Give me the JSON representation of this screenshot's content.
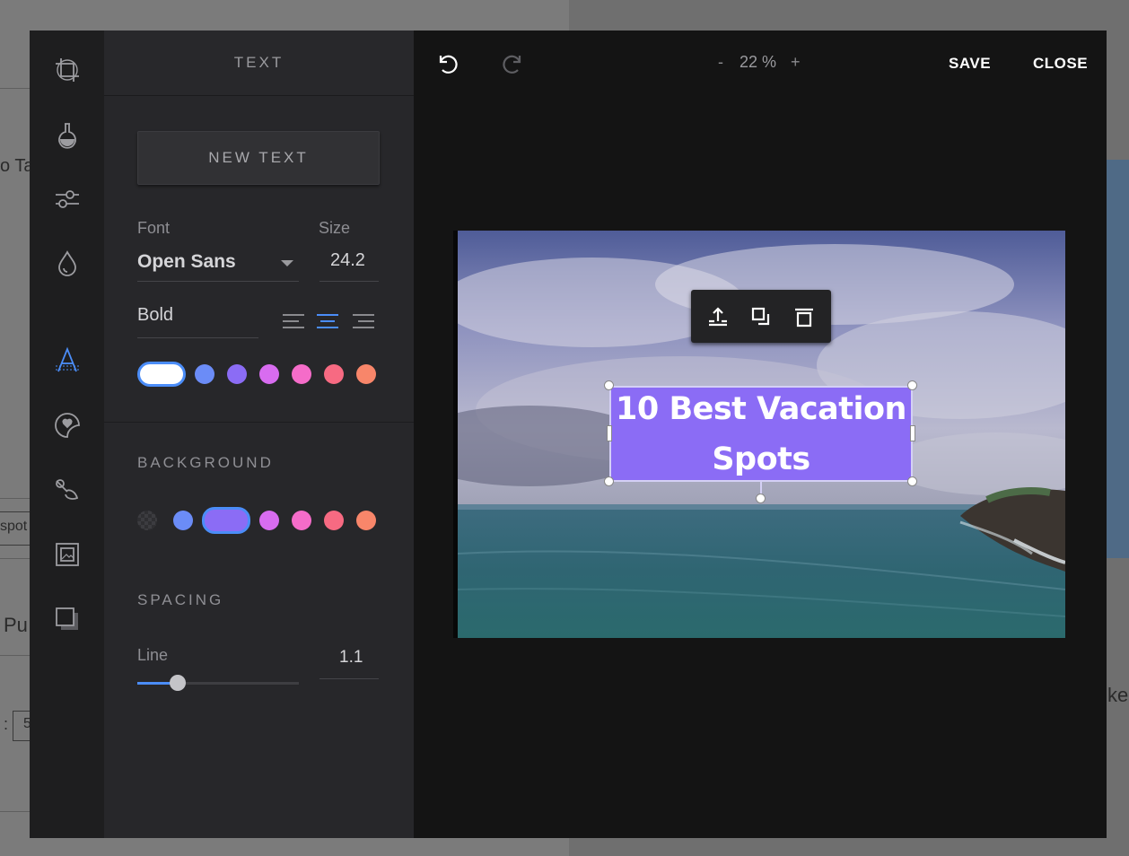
{
  "background_page": {
    "fragments": [
      "o Ta",
      "spot",
      "Pu",
      "ke",
      ":",
      "5"
    ]
  },
  "tools": [
    {
      "name": "crop-icon"
    },
    {
      "name": "filter-flask-icon"
    },
    {
      "name": "adjust-sliders-icon"
    },
    {
      "name": "focus-drop-icon"
    },
    {
      "name": "text-tool-icon",
      "active": true
    },
    {
      "name": "sticker-icon"
    },
    {
      "name": "brush-icon"
    },
    {
      "name": "frame-icon"
    },
    {
      "name": "overlay-icon"
    }
  ],
  "panel": {
    "title": "TEXT",
    "new_text": "NEW TEXT",
    "font_label": "Font",
    "font_value": "Open Sans",
    "size_label": "Size",
    "size_value": "24.2",
    "weight_value": "Bold",
    "alignment": "center",
    "text_colors": [
      "#ffffff",
      "#6b8cf7",
      "#8b6cf5",
      "#d86cf0",
      "#f56cc9",
      "#f76a82",
      "#f8866a"
    ],
    "selected_text_color": "#ffffff",
    "background_title": "BACKGROUND",
    "background_colors": [
      "transparent",
      "#6b8cf7",
      "#8b6cf5",
      "#d86cf0",
      "#f56cc9",
      "#f76a82",
      "#f8866a"
    ],
    "selected_background_color": "#8b6cf5",
    "spacing_title": "SPACING",
    "line_label": "Line",
    "line_value": "1.1",
    "line_slider_fraction": 0.25
  },
  "topbar": {
    "zoom_minus": "-",
    "zoom_value": "22 %",
    "zoom_plus": "+",
    "save": "SAVE",
    "close": "CLOSE"
  },
  "canvas": {
    "text_content": "10 Best Vacation\nSpots",
    "text_bg_color": "#8b6cf5"
  },
  "colors": {
    "accent": "#4b8df8",
    "modal_bg": "#141414",
    "panel_bg": "#27272a"
  }
}
